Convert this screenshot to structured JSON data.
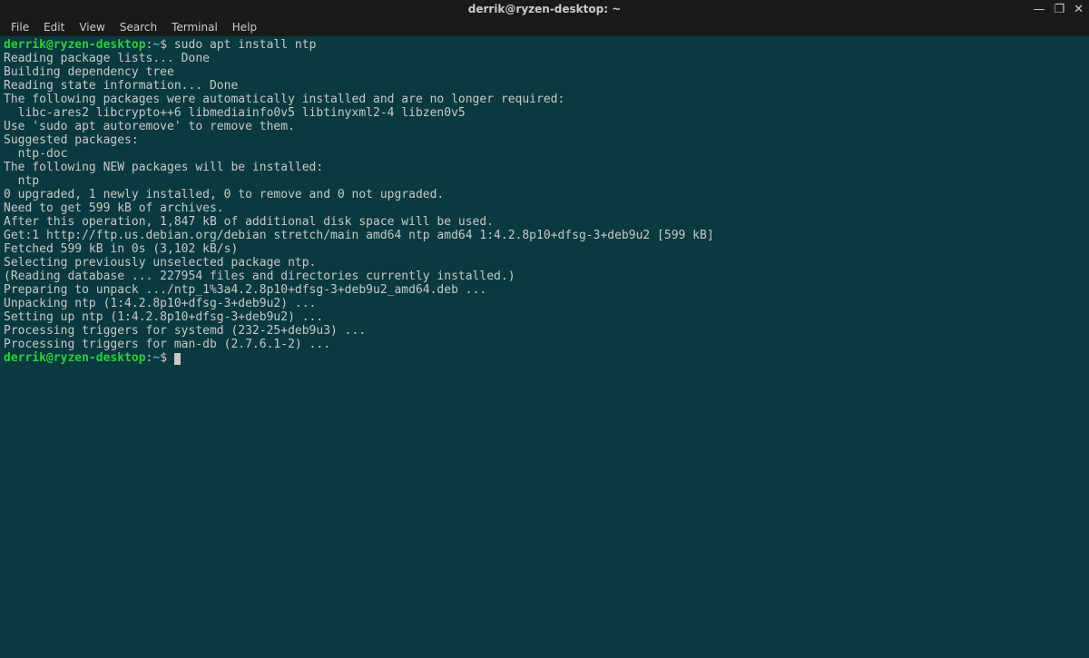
{
  "window": {
    "title": "derrik@ryzen-desktop: ~"
  },
  "menubar": {
    "items": [
      "File",
      "Edit",
      "View",
      "Search",
      "Terminal",
      "Help"
    ]
  },
  "prompt": {
    "userhost": "derrik@ryzen-desktop",
    "colon": ":",
    "path": "~",
    "dollar": "$ "
  },
  "session": {
    "command1": "sudo apt install ntp",
    "output_lines": [
      "Reading package lists... Done",
      "Building dependency tree",
      "Reading state information... Done",
      "The following packages were automatically installed and are no longer required:",
      "  libc-ares2 libcrypto++6 libmediainfo0v5 libtinyxml2-4 libzen0v5",
      "Use 'sudo apt autoremove' to remove them.",
      "Suggested packages:",
      "  ntp-doc",
      "The following NEW packages will be installed:",
      "  ntp",
      "0 upgraded, 1 newly installed, 0 to remove and 0 not upgraded.",
      "Need to get 599 kB of archives.",
      "After this operation, 1,847 kB of additional disk space will be used.",
      "Get:1 http://ftp.us.debian.org/debian stretch/main amd64 ntp amd64 1:4.2.8p10+dfsg-3+deb9u2 [599 kB]",
      "Fetched 599 kB in 0s (3,102 kB/s)",
      "Selecting previously unselected package ntp.",
      "(Reading database ... 227954 files and directories currently installed.)",
      "Preparing to unpack .../ntp_1%3a4.2.8p10+dfsg-3+deb9u2_amd64.deb ...",
      "Unpacking ntp (1:4.2.8p10+dfsg-3+deb9u2) ...",
      "Setting up ntp (1:4.2.8p10+dfsg-3+deb9u2) ...",
      "Processing triggers for systemd (232-25+deb9u3) ...",
      "Processing triggers for man-db (2.7.6.1-2) ..."
    ]
  }
}
